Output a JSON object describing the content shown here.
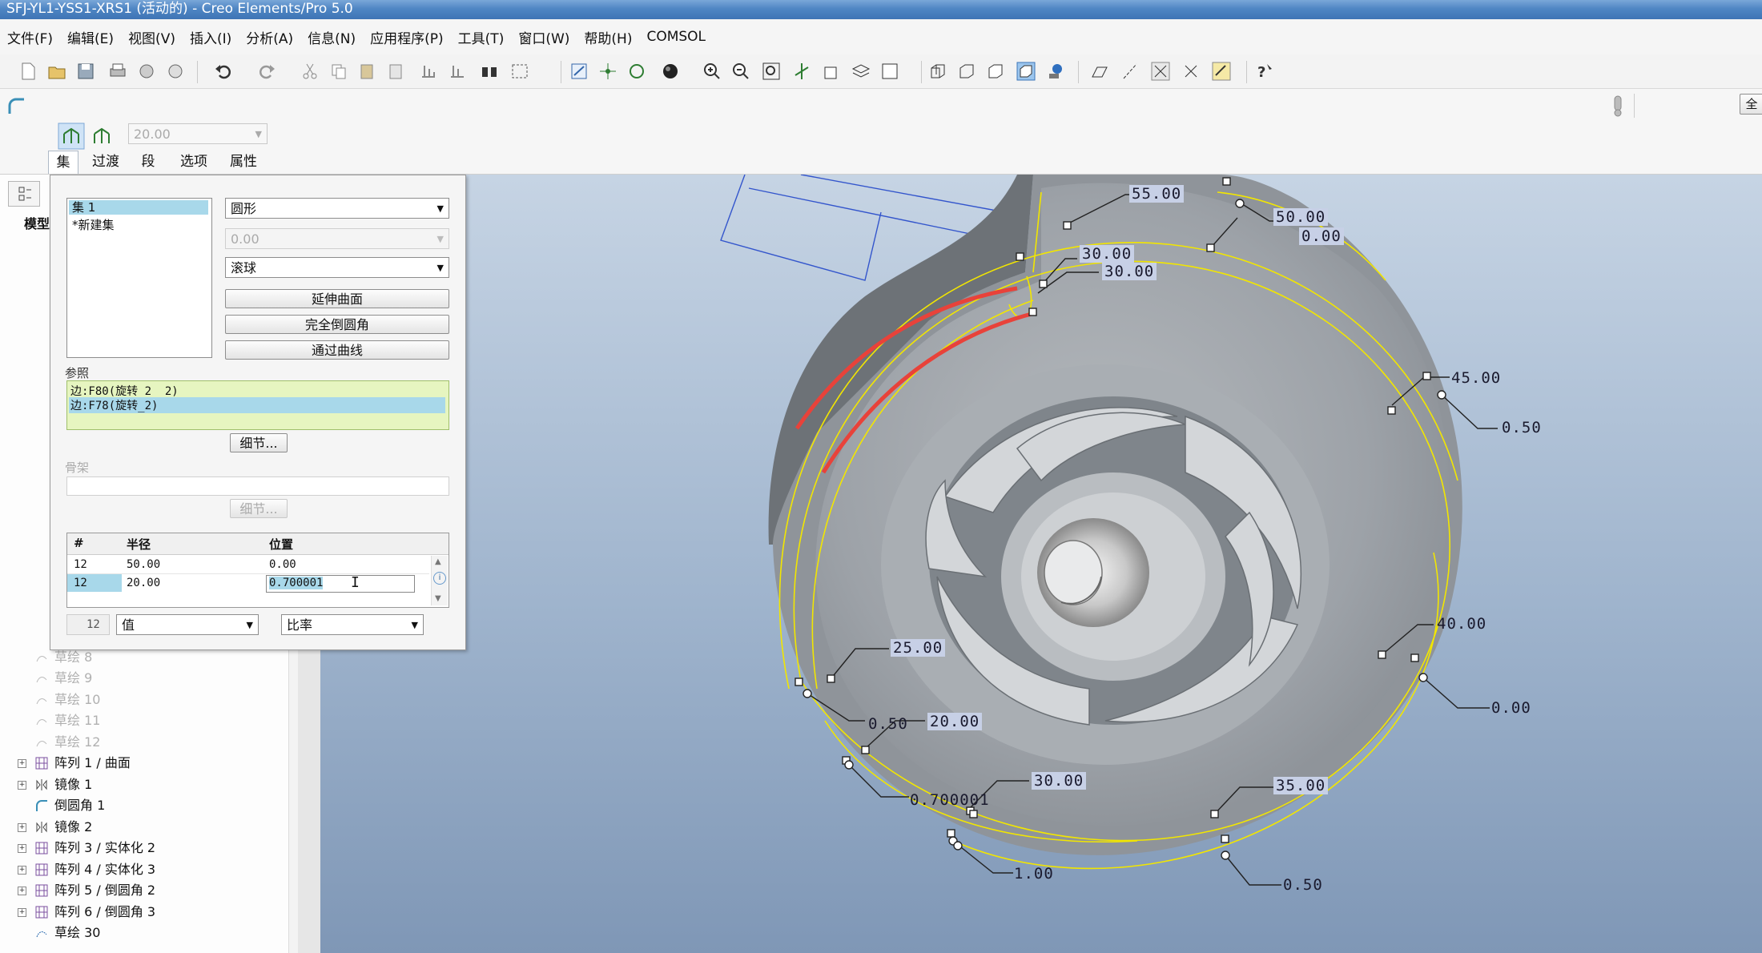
{
  "window": {
    "title": "SFJ-YL1-YSS1-XRS1 (活动的) - Creo Elements/Pro 5.0"
  },
  "menu": [
    "文件(F)",
    "编辑(E)",
    "视图(V)",
    "插入(I)",
    "分析(A)",
    "信息(N)",
    "应用程序(P)",
    "工具(T)",
    "窗口(W)",
    "帮助(H)",
    "COMSOL"
  ],
  "dashboard": {
    "radius_value": "20.00",
    "tabs": [
      "集",
      "过渡",
      "段",
      "选项",
      "属性"
    ],
    "right_button": "全"
  },
  "panel": {
    "sets": [
      "集 1",
      "*新建集"
    ],
    "shape": "圆形",
    "distance_value": "0.00",
    "method": "滚球",
    "buttons": [
      "延伸曲面",
      "完全倒圆角",
      "通过曲线"
    ],
    "references_label": "参照",
    "references": [
      "边:F80(旋转_2__2)",
      "边:F78(旋转_2)"
    ],
    "details_button": "细节...",
    "skeleton_label": "骨架",
    "skeleton_details_button": "细节...",
    "table": {
      "headers": [
        "#",
        "半径",
        "位置"
      ],
      "rows": [
        [
          "12",
          "50.00",
          "0.00"
        ],
        [
          "12",
          "20.00",
          "0.700001"
        ]
      ]
    },
    "bottom_number": "12",
    "value_mode": "值",
    "ratio_mode": "比率"
  },
  "tree": {
    "header": "模型",
    "items": [
      {
        "label": "草绘 8",
        "dim": true
      },
      {
        "label": "草绘 9",
        "dim": true
      },
      {
        "label": "草绘 10",
        "dim": true
      },
      {
        "label": "草绘 11",
        "dim": true
      },
      {
        "label": "草绘 12",
        "dim": true
      },
      {
        "label": "阵列 1 / 曲面",
        "dim": false
      },
      {
        "label": "镜像 1",
        "dim": false
      },
      {
        "label": "倒圆角 1",
        "dim": false
      },
      {
        "label": "镜像 2",
        "dim": false
      },
      {
        "label": "阵列 3 / 实体化 2",
        "dim": false
      },
      {
        "label": "阵列 4 / 实体化 3",
        "dim": false
      },
      {
        "label": "阵列 5 / 倒圆角 2",
        "dim": false
      },
      {
        "label": "阵列 6 / 倒圆角 3",
        "dim": false
      },
      {
        "label": "草绘 30",
        "dim": false
      }
    ]
  },
  "dimensions": [
    "55.00",
    "50.00",
    "0.00",
    "30.00",
    "30.00",
    "45.00",
    "0.50",
    "40.00",
    "0.00",
    "25.00",
    "0.50",
    "20.00",
    "30.00",
    "0.700001",
    "35.00",
    "1.00",
    "0.50"
  ],
  "colors": {
    "accent_selection": "#a8d8ea",
    "reference_bg": "#e6f5c0",
    "edge_highlight": "#e8423a",
    "construction_curve": "#f2e600",
    "viewport_bg": "#9fb4cd"
  }
}
